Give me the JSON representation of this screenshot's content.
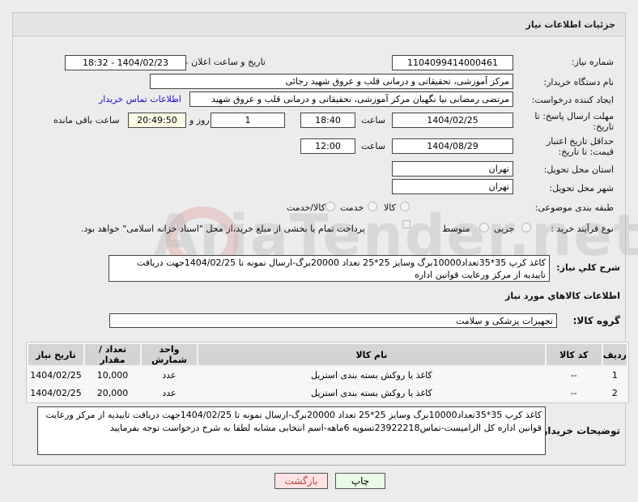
{
  "header": {
    "title": "جزئیات اطلاعات نیاز"
  },
  "watermark": "AriaTender.net",
  "form": {
    "need_number_label": "شماره نیاز:",
    "need_number": "1104099414000461",
    "announce_label": "تاریخ و ساعت اعلان عمومی:",
    "announce_value": "1404/02/23 - 18:32",
    "buyer_org_label": "نام دستگاه خریدار:",
    "buyer_org": "مرکز آموزشی، تحقیقاتی و درمانی قلب و عروق شهید رجائی",
    "creator_label": "ایجاد کننده درخواست:",
    "creator": "مرتضی رمضانی نیا نگهبان مرکز آموزشی، تحقیقاتی و درمانی قلب و عروق شهید",
    "contact_link": "اطلاعات تماس خریدار",
    "deadline_label": "مهلت ارسال پاسخ: تا تاریخ:",
    "deadline_date": "1404/02/25",
    "time_label": "ساعت",
    "deadline_time": "18:40",
    "days": "1",
    "days_label": "روز و",
    "remaining": "20:49:50",
    "remaining_label": "ساعت باقی مانده",
    "validity_label": "حداقل تاریخ اعتبار قیمت: تا تاریخ:",
    "validity_date": "1404/08/29",
    "validity_time": "12:00",
    "province_label": "استان محل تحویل:",
    "province": "تهران",
    "city_label": "شهر محل تحویل:",
    "city": "تهران",
    "category_label": "طبقه بندی موضوعی:",
    "category_options": [
      "کالا",
      "خدمت",
      "کالا/خدمت"
    ],
    "process_label": "نوع فرآیند خرید :",
    "process_options": [
      "جزیی",
      "متوسط"
    ],
    "payment_note": "پرداخت تمام یا بخشی از مبلغ خرید،از محل \"اسناد خزانه اسلامی\" خواهد بود.",
    "desc_label": "شرح کلي نیاز:",
    "desc": "کاغذ کرپ 35*35تعداد10000برگ وسایز 25*25 تعداد 20000برگ-ارسال نمونه تا 1404/02/25جهت دریافت تاییدیه از مرکز ورعایت قوانین اداره",
    "goods_info_title": "اطلاعات کالاهاي مورد نیاز",
    "group_label": "گروه کالا:",
    "group": "تجهیزات پزشکی و سلامت"
  },
  "table": {
    "headers": [
      "ردیف",
      "کد کالا",
      "نام کالا",
      "واحد شمارش",
      "تعداد / مقدار",
      "تاریخ نیاز"
    ],
    "rows": [
      [
        "1",
        "--",
        "کاغذ یا روکش بسته بندی استریل",
        "عدد",
        "10,000",
        "1404/02/25"
      ],
      [
        "2",
        "--",
        "کاغذ یا روکش بسته بندی استریل",
        "عدد",
        "20,000",
        "1404/02/25"
      ]
    ]
  },
  "notes": {
    "label": "توضیحات خریدار:",
    "text": "کاغذ کرپ 35*35تعداد10000برگ وسایز 25*25 تعداد 20000برگ-ارسال نمونه تا 1404/02/25جهت دریافت تاییدیه از مرکز ورعایت قوانین اداره کل الزامیست-تماس23922218تسویه 6ماهه-اسم انتخابی مشابه لطفا به شرح درخواست توجه بفرمایید"
  },
  "buttons": {
    "print": "چاپ",
    "back": "بازگشت"
  }
}
